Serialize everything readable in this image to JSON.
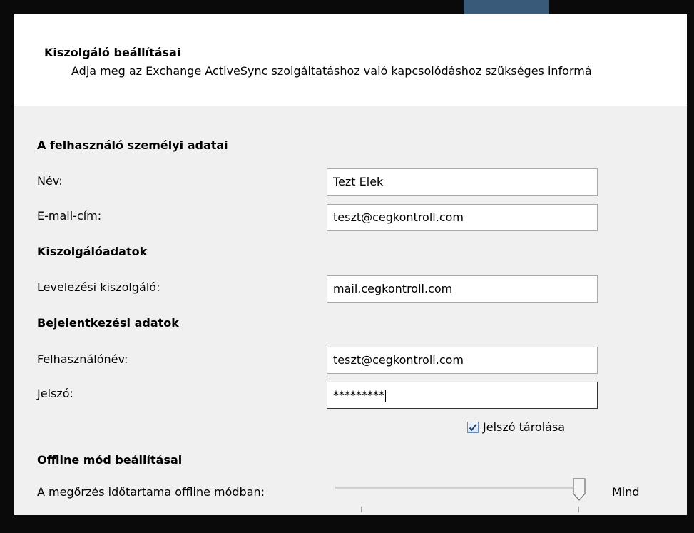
{
  "header": {
    "title": "Kiszolgáló beállításai",
    "subtitle": "Adja meg az Exchange ActiveSync szolgáltatáshoz való kapcsolódáshoz szükséges informá"
  },
  "personal": {
    "heading": "A felhasználó személyi adatai",
    "name_label": "Név:",
    "name_value": "Tezt  Elek",
    "email_label": "E-mail-cím:",
    "email_value": "teszt@cegkontroll.com"
  },
  "server": {
    "heading": "Kiszolgálóadatok",
    "mail_server_label": "Levelezési kiszolgáló:",
    "mail_server_value": "mail.cegkontroll.com"
  },
  "login": {
    "heading": "Bejelentkezési adatok",
    "username_label": "Felhasználónév:",
    "username_value": "teszt@cegkontroll.com",
    "password_label": "Jelszó:",
    "password_value": "*********",
    "remember_label": "Jelszó tárolása",
    "remember_checked": true
  },
  "offline": {
    "heading": "Offline mód beállításai",
    "retention_label": "A megőrzés időtartama offline módban:",
    "slider_value_label": "Mind",
    "slider_level": 1.0
  },
  "icons": {
    "checkbox": "checkmark-icon"
  },
  "colors": {
    "dialog_bg": "#f0f0f0",
    "header_bg": "#ffffff",
    "field_border": "#a8a8a8"
  }
}
